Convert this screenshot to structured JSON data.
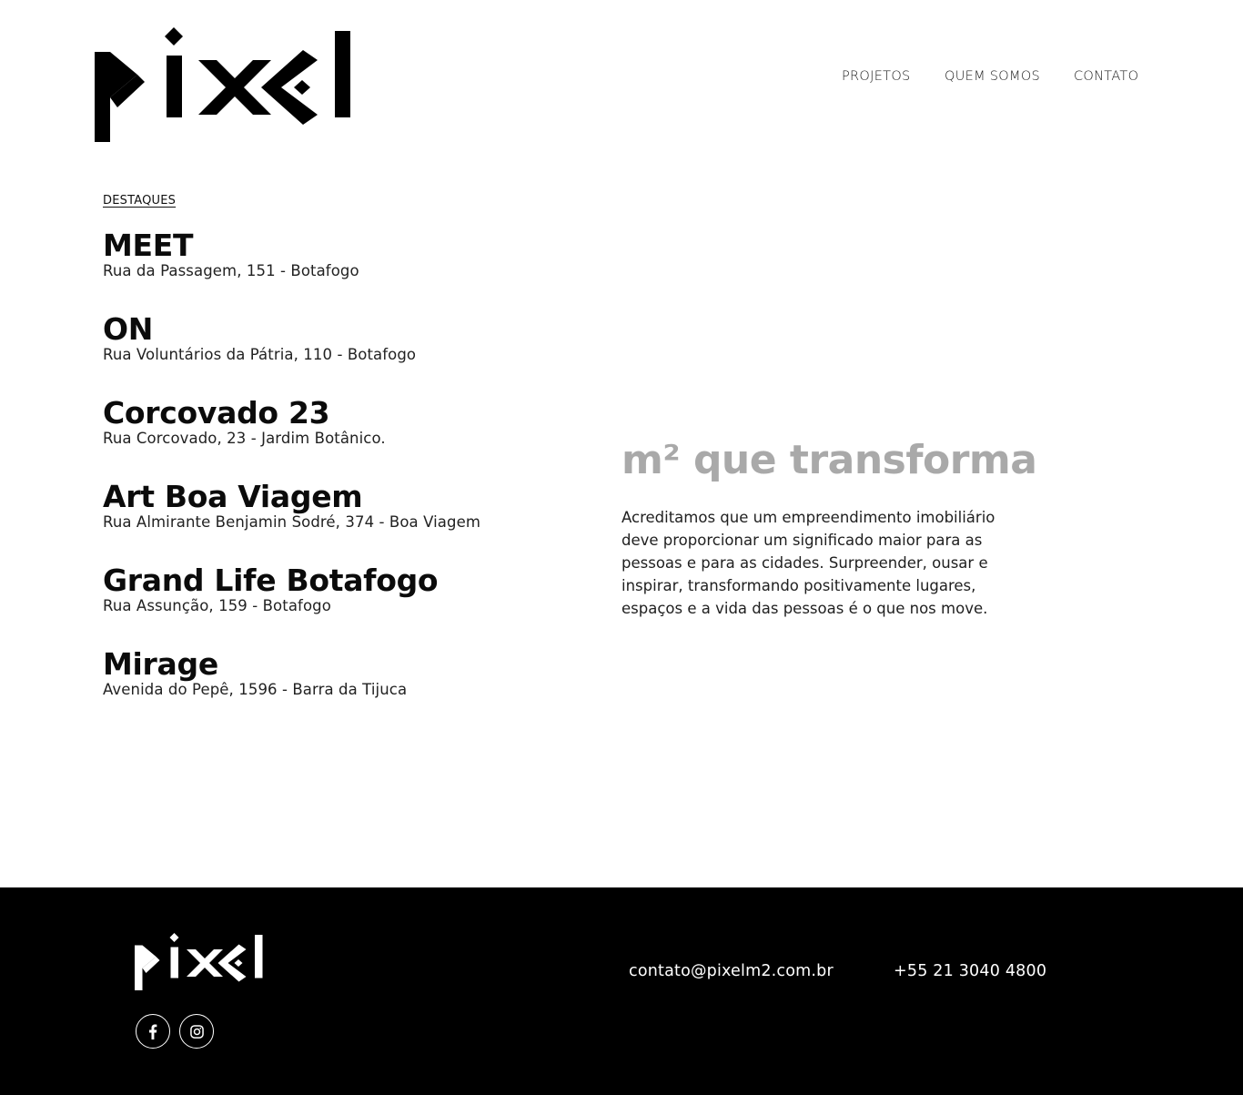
{
  "brand": {
    "logo_text": "pixel",
    "logo_color": "#000000",
    "footer_logo_color": "#ffffff"
  },
  "nav": {
    "items": [
      {
        "label": "PROJETOS"
      },
      {
        "label": "QUEM SOMOS"
      },
      {
        "label": "CONTATO"
      }
    ]
  },
  "highlights": {
    "section_label": "DESTAQUES",
    "projects": [
      {
        "name": "MEET",
        "address": "Rua da Passagem, 151 - Botafogo"
      },
      {
        "name": "ON",
        "address": "Rua Voluntários da Pátria, 110 - Botafogo"
      },
      {
        "name": "Corcovado 23",
        "address": "Rua Corcovado, 23 - Jardim Botânico."
      },
      {
        "name": "Art Boa Viagem",
        "address": "Rua Almirante Benjamin Sodré, 374 - Boa Viagem"
      },
      {
        "name": "Grand Life Botafogo",
        "address": "Rua Assunção, 159 - Botafogo"
      },
      {
        "name": "Mirage",
        "address": "Avenida do Pepê, 1596 - Barra da Tijuca"
      }
    ]
  },
  "about": {
    "tagline": "m² que transforma",
    "tagline_color": "#a9a9a9",
    "text": "Acreditamos que um empreendimento imobiliário deve proporcionar um significado maior para as pessoas e para as cidades. Surpreender, ousar e inspirar, transformando positivamente lugares, espaços e a vida das pessoas é o que nos move."
  },
  "footer": {
    "background": "#000000",
    "email": "contato@pixelm2.com.br",
    "phone": "+55 21 3040 4800",
    "social": [
      {
        "icon": "facebook-icon"
      },
      {
        "icon": "instagram-icon"
      }
    ]
  }
}
